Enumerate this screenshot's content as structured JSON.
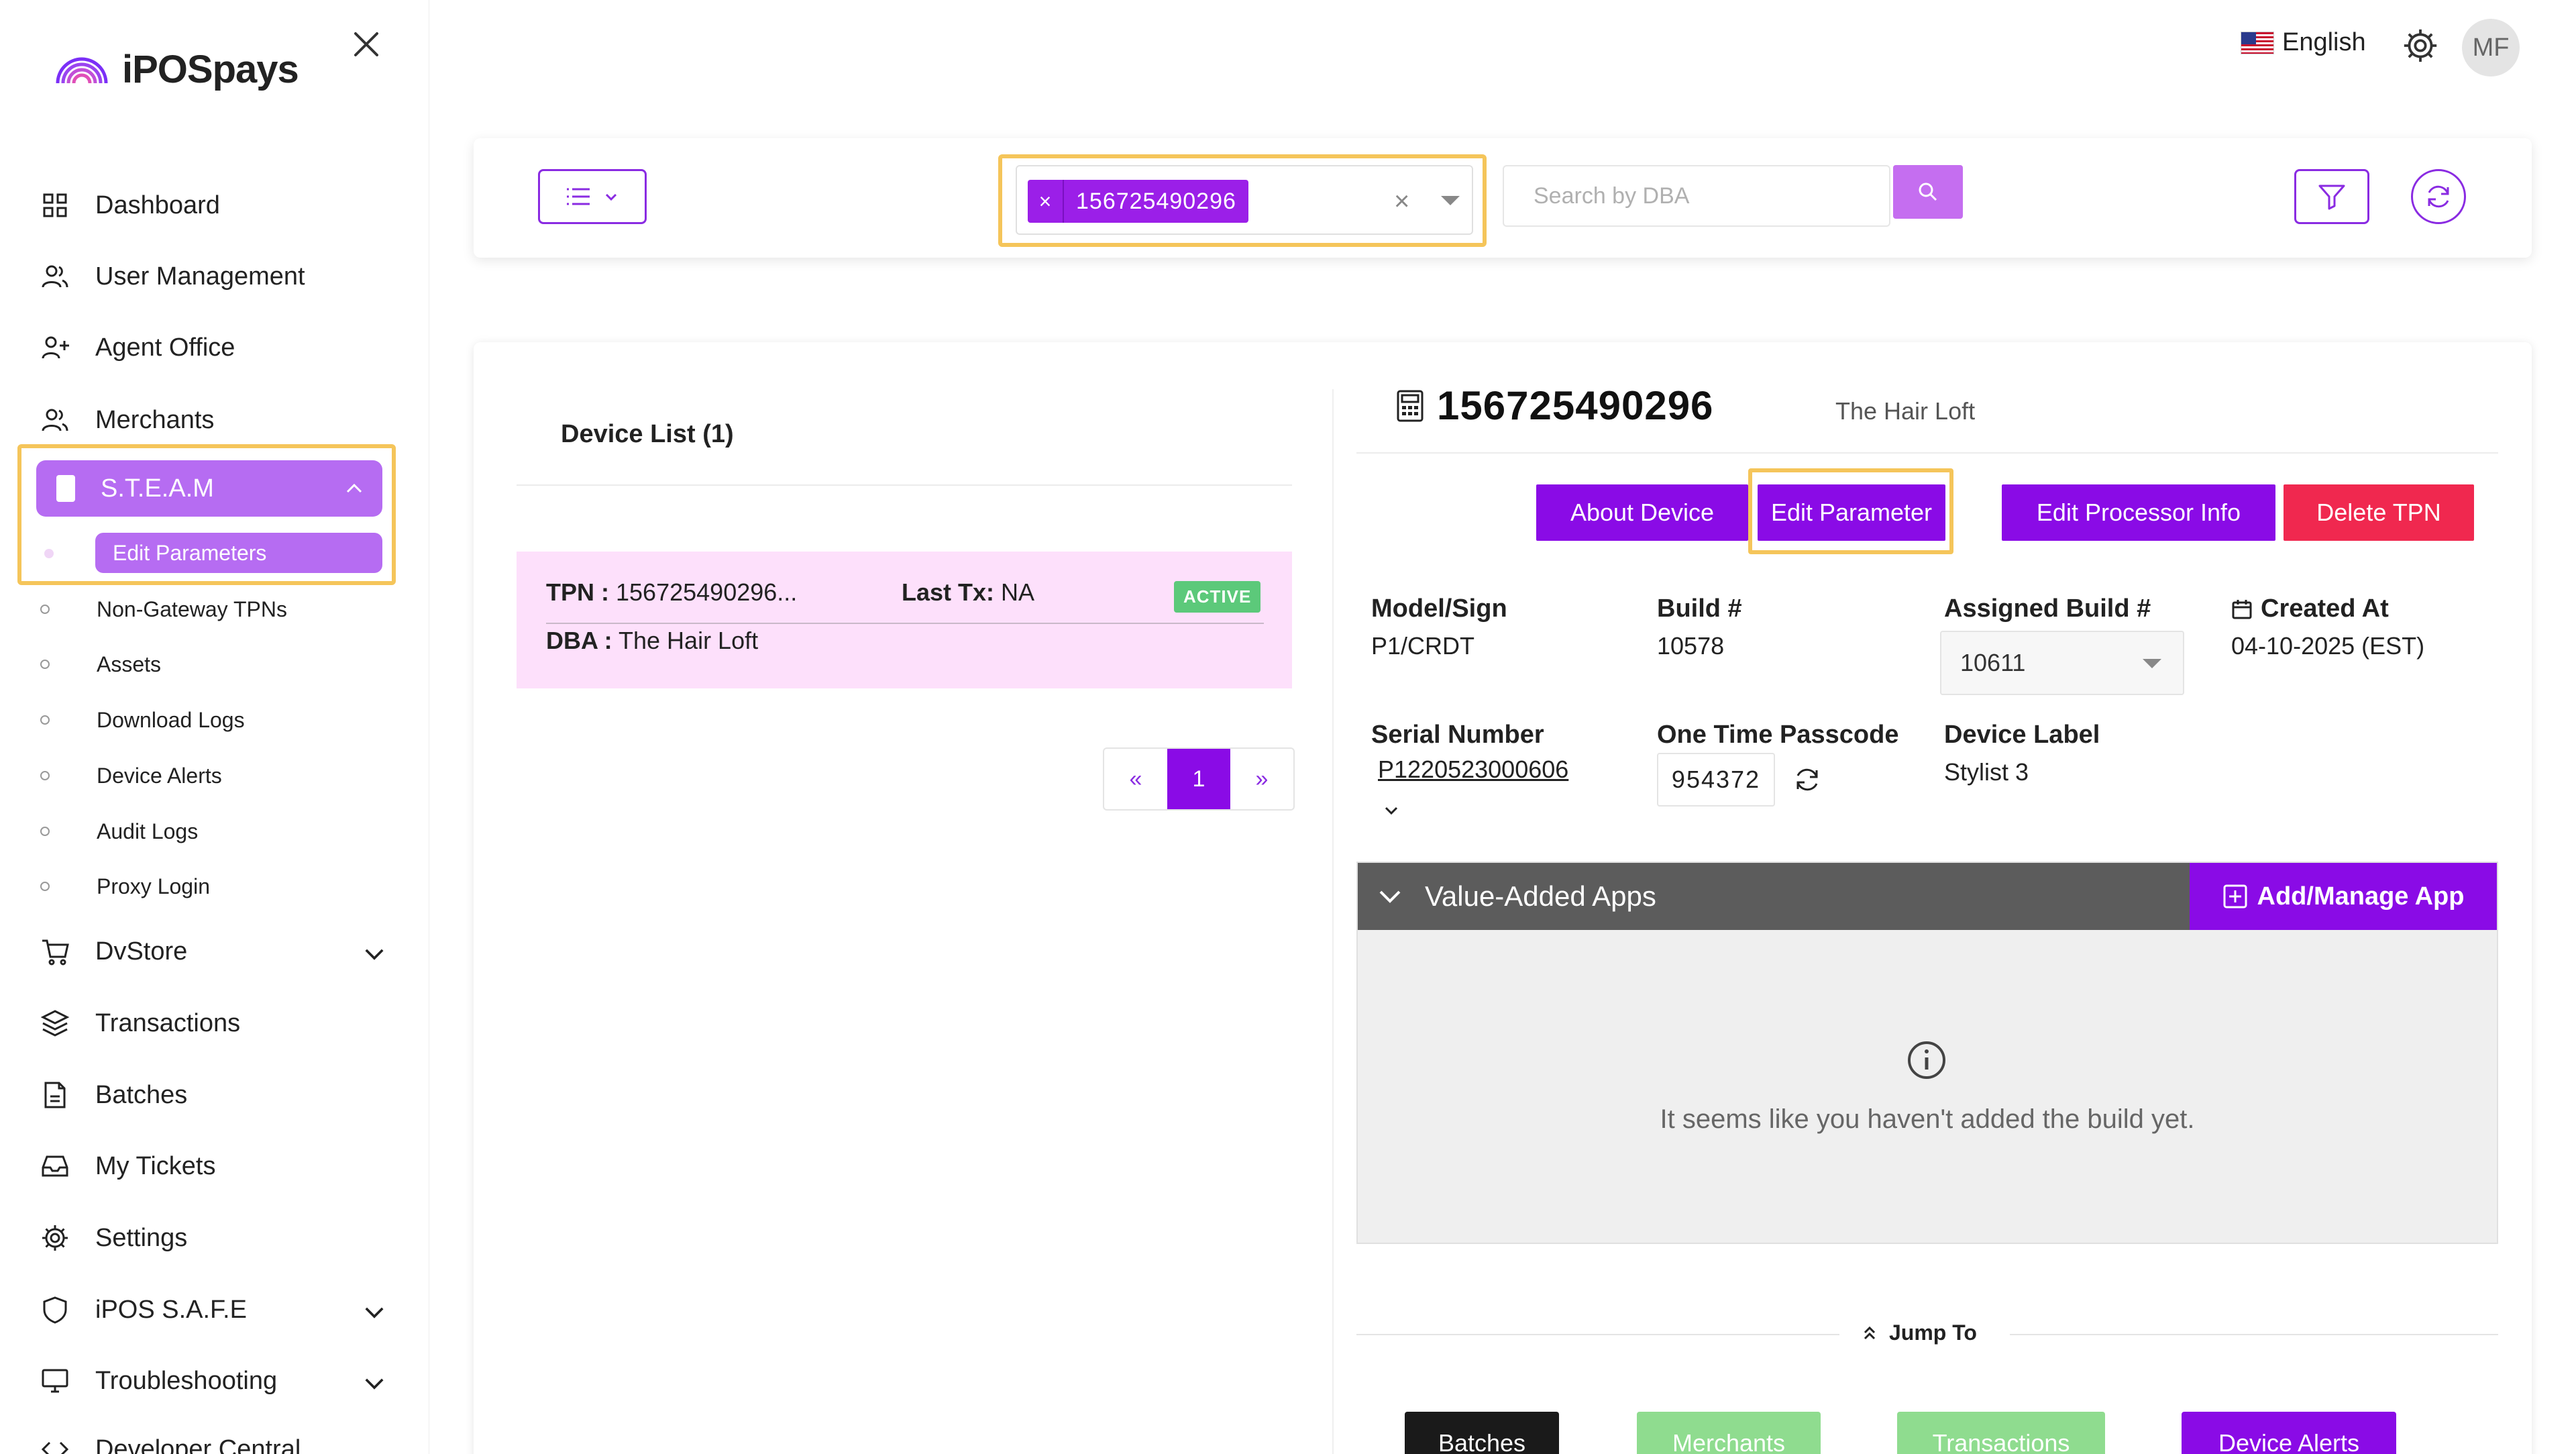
{
  "brand": {
    "name": "iPOSpays"
  },
  "header": {
    "language": "English",
    "avatar_initials": "MF"
  },
  "sidebar": {
    "items": [
      {
        "label": "Dashboard",
        "icon": "grid-icon"
      },
      {
        "label": "User Management",
        "icon": "users-icon"
      },
      {
        "label": "Agent Office",
        "icon": "user-plus-icon"
      },
      {
        "label": "Merchants",
        "icon": "users-icon"
      },
      {
        "label": "S.T.E.A.M",
        "icon": "tablet-icon"
      },
      {
        "label": "DvStore",
        "icon": "cart-icon"
      },
      {
        "label": "Transactions",
        "icon": "layers-icon"
      },
      {
        "label": "Batches",
        "icon": "file-icon"
      },
      {
        "label": "My Tickets",
        "icon": "inbox-icon"
      },
      {
        "label": "Settings",
        "icon": "gear-icon"
      },
      {
        "label": "iPOS S.A.F.E",
        "icon": "shield-icon"
      },
      {
        "label": "Troubleshooting",
        "icon": "monitor-icon"
      },
      {
        "label": "Developer Central",
        "icon": "code-icon"
      }
    ],
    "steam_sub": [
      {
        "label": "Edit Parameters"
      },
      {
        "label": "Non-Gateway TPNs"
      },
      {
        "label": "Assets"
      },
      {
        "label": "Download Logs"
      },
      {
        "label": "Device Alerts"
      },
      {
        "label": "Audit Logs"
      },
      {
        "label": "Proxy Login"
      }
    ]
  },
  "filter": {
    "selected_tpn": "156725490296",
    "search_placeholder": "Search by DBA"
  },
  "device_list": {
    "title": "Device List (1)",
    "card": {
      "tpn_label": "TPN :",
      "tpn_value": "156725490296...",
      "last_tx_label": "Last Tx:",
      "last_tx_value": "NA",
      "status": "ACTIVE",
      "dba_label": "DBA :",
      "dba_value": "The Hair Loft"
    },
    "pager": {
      "prev": "«",
      "current": "1",
      "next": "»"
    }
  },
  "device": {
    "tpn": "156725490296",
    "dba": "The Hair Loft",
    "actions": {
      "about": "About Device",
      "edit_parameter": "Edit Parameter",
      "edit_processor": "Edit Processor Info",
      "delete": "Delete TPN"
    },
    "fields": {
      "model_label": "Model/Sign",
      "model_value": "P1/CRDT",
      "build_label": "Build #",
      "build_value": "10578",
      "assigned_label": "Assigned Build #",
      "assigned_value": "10611",
      "created_label": "Created At",
      "created_value": "04-10-2025 (EST)",
      "serial_label": "Serial Number",
      "serial_value": "P1220523000606",
      "otp_label": "One Time Passcode",
      "otp_value": "954372",
      "device_label_label": "Device Label",
      "device_label_value": "Stylist 3"
    }
  },
  "vaa": {
    "title": "Value-Added Apps",
    "add_button": "Add/Manage App",
    "empty_message": "It seems like you haven't added the build yet."
  },
  "jump": {
    "label": "Jump To",
    "buttons": [
      {
        "label": "Batches",
        "color": "#1a1a1a"
      },
      {
        "label": "Merchants",
        "color": "#8fdc8f"
      },
      {
        "label": "Transactions",
        "color": "#8fdc8f"
      },
      {
        "label": "Device Alerts",
        "color": "#8a0be6"
      }
    ]
  },
  "colors": {
    "primary": "#8a0be6",
    "sidebar_active": "#b66cf2",
    "highlight": "#f5c55a",
    "danger": "#f0284f",
    "success": "#5cc97a"
  }
}
